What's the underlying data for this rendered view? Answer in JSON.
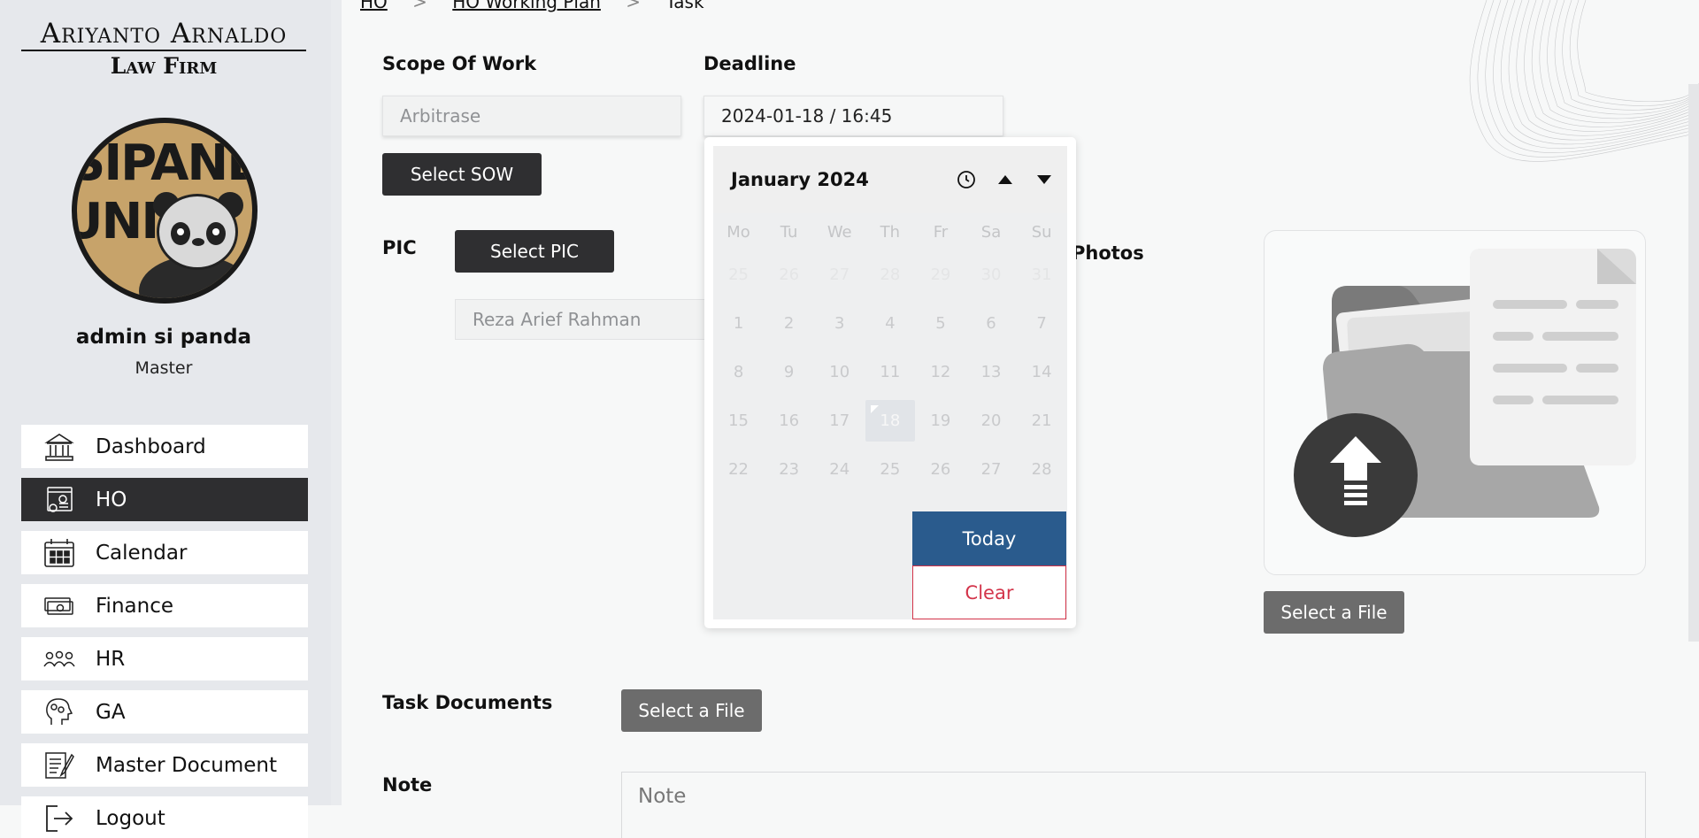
{
  "brand": {
    "line1": "Ariyanto Arnaldo",
    "line2": "Law Firm",
    "avatar_text_1": "SIPANDA",
    "avatar_text_2": "UNIK"
  },
  "user": {
    "name": "admin si panda",
    "role": "Master"
  },
  "nav": {
    "items": [
      {
        "label": "Dashboard",
        "icon": "bank-icon",
        "active": false
      },
      {
        "label": "HO",
        "icon": "web-settings-icon",
        "active": true
      },
      {
        "label": "Calendar",
        "icon": "calendar-icon",
        "active": false
      },
      {
        "label": "Finance",
        "icon": "money-icon",
        "active": false
      },
      {
        "label": "HR",
        "icon": "people-icon",
        "active": false
      },
      {
        "label": "GA",
        "icon": "head-gears-icon",
        "active": false
      },
      {
        "label": "Master Document",
        "icon": "document-edit-icon",
        "active": false
      },
      {
        "label": "Logout",
        "icon": "logout-icon",
        "active": false
      }
    ]
  },
  "breadcrumb": {
    "items": [
      "HO",
      "HO Working Plan",
      "Task"
    ],
    "separator": ">"
  },
  "form": {
    "scope_label": "Scope Of Work",
    "scope_value": "Arbitrase",
    "select_sow": "Select SOW",
    "deadline_label": "Deadline",
    "deadline_value": "2024-01-18 / 16:45",
    "pic_label": "PIC",
    "select_pic": "Select PIC",
    "pic_value": "Reza Arief Rahman",
    "photos_label": "Photos",
    "select_file_photo": "Select a File",
    "task_docs_label": "Task Documents",
    "select_file_docs": "Select a File",
    "note_label": "Note",
    "note_placeholder": "Note"
  },
  "datepicker": {
    "month_title": "January 2024",
    "weekdays": [
      "Mo",
      "Tu",
      "We",
      "Th",
      "Fr",
      "Sa",
      "Su"
    ],
    "weeks": [
      [
        "25",
        "26",
        "27",
        "28",
        "29",
        "30",
        "31"
      ],
      [
        "1",
        "2",
        "3",
        "4",
        "5",
        "6",
        "7"
      ],
      [
        "8",
        "9",
        "10",
        "11",
        "12",
        "13",
        "14"
      ],
      [
        "15",
        "16",
        "17",
        "18",
        "19",
        "20",
        "21"
      ],
      [
        "22",
        "23",
        "24",
        "25",
        "26",
        "27",
        "28"
      ]
    ],
    "selected_day": "18",
    "today_label": "Today",
    "clear_label": "Clear"
  },
  "colors": {
    "sidebar_bg": "#e6e8ec",
    "active_nav": "#2e2e30",
    "today_btn": "#2a5b8d",
    "clear_btn": "#d3344a",
    "dark_btn": "#2f2f31",
    "grey_btn": "#6c6c6c"
  }
}
